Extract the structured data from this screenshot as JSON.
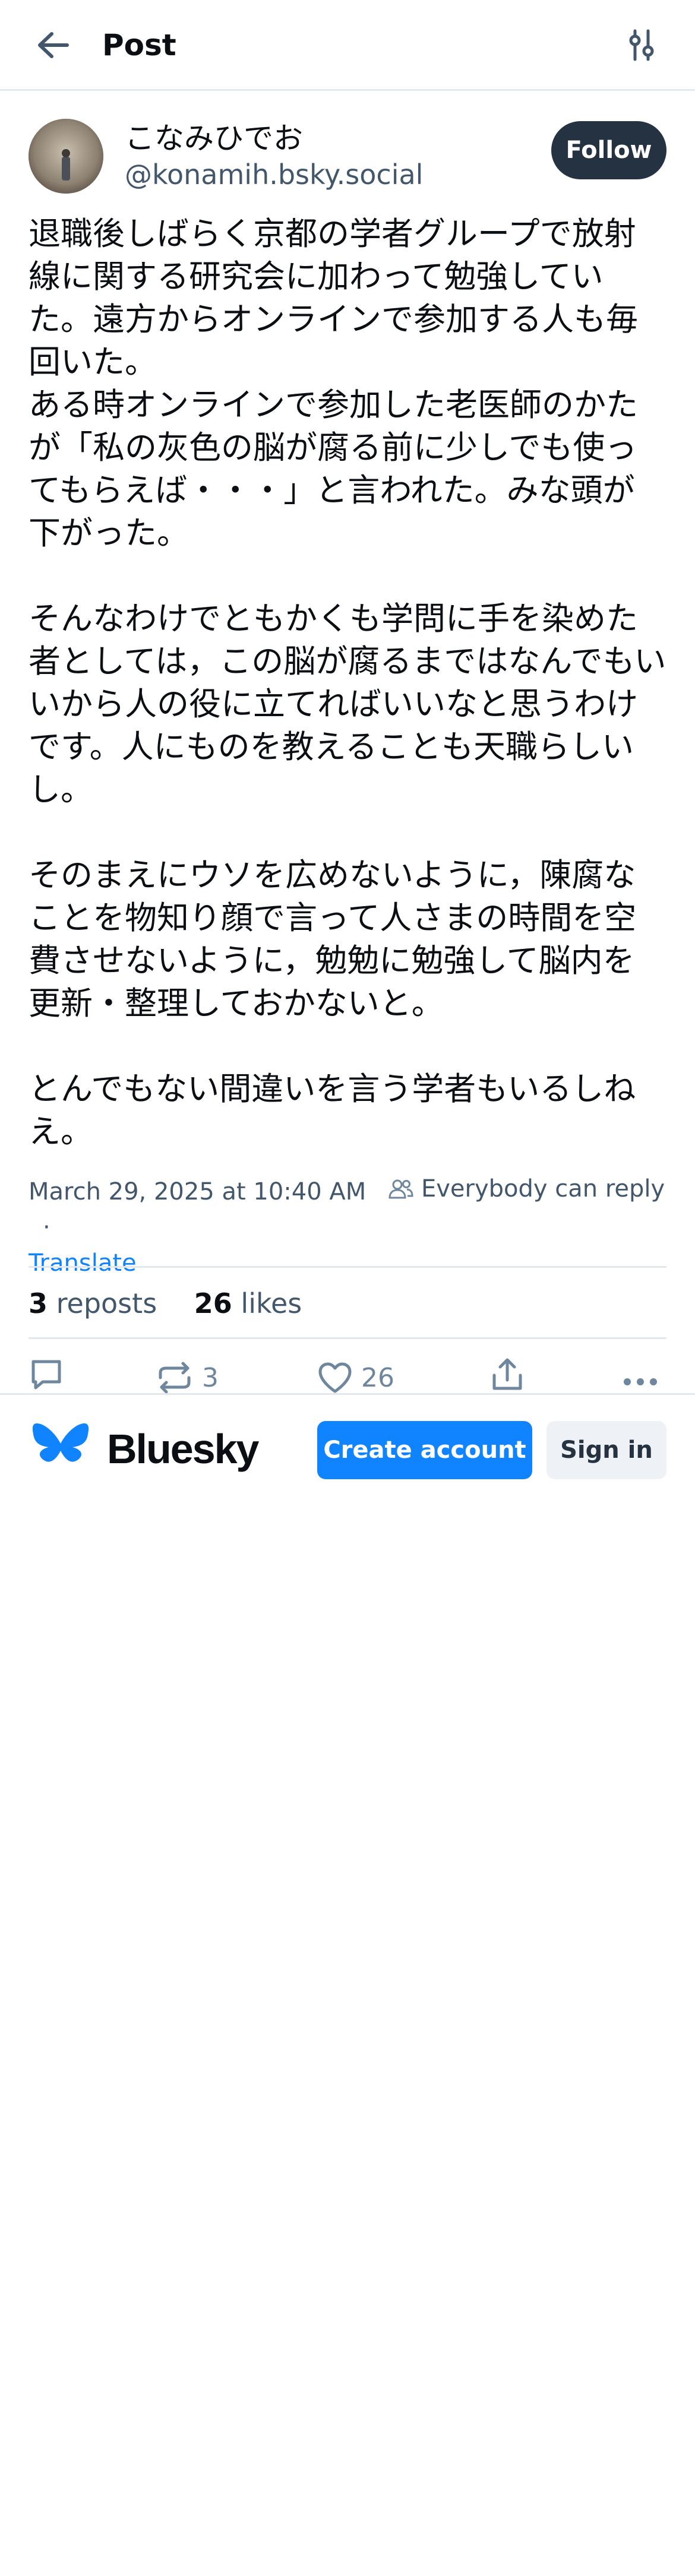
{
  "header": {
    "title": "Post"
  },
  "author": {
    "display_name": "こなみひでお",
    "handle": "@konamih.bsky.social",
    "follow_label": "Follow"
  },
  "post": {
    "text": "退職後しばらく京都の学者グループで放射線に関する研究会に加わって勉強していた。遠方からオンラインで参加する人も毎回いた。\nある時オンラインで参加した老医師のかたが「私の灰色の脳が腐る前に少しでも使ってもらえば・・・」と言われた。みな頭が下がった。\n\nそんなわけでともかくも学問に手を染めた者としては，この脳が腐るまではなんでもいいから人の役に立てればいいなと思うわけです。人にものを教えることも天職らしいし。\n\nそのまえにウソを広めないように，陳腐なことを物知り顔で言って人さまの時間を空費させないように，勉勉に勉強して脳内を更新・整理しておかないと。\n\nとんでもない間違いを言う学者もいるしねえ。",
    "timestamp": "March 29, 2025 at 10:40 AM",
    "reply_setting": "Everybody can reply",
    "separator": "·",
    "translate_label": "Translate"
  },
  "stats": {
    "reposts_count": "3",
    "reposts_label": "reposts",
    "likes_count": "26",
    "likes_label": "likes"
  },
  "actions": {
    "repost_count": "3",
    "like_count": "26"
  },
  "bottom_bar": {
    "brand": "Bluesky",
    "create_account_label": "Create account",
    "sign_in_label": "Sign in"
  },
  "colors": {
    "accent": "#1083fe",
    "follow_bg": "#253242",
    "muted_text": "#42576c",
    "icon": "#6f869f",
    "divider": "#e3e8ee"
  }
}
